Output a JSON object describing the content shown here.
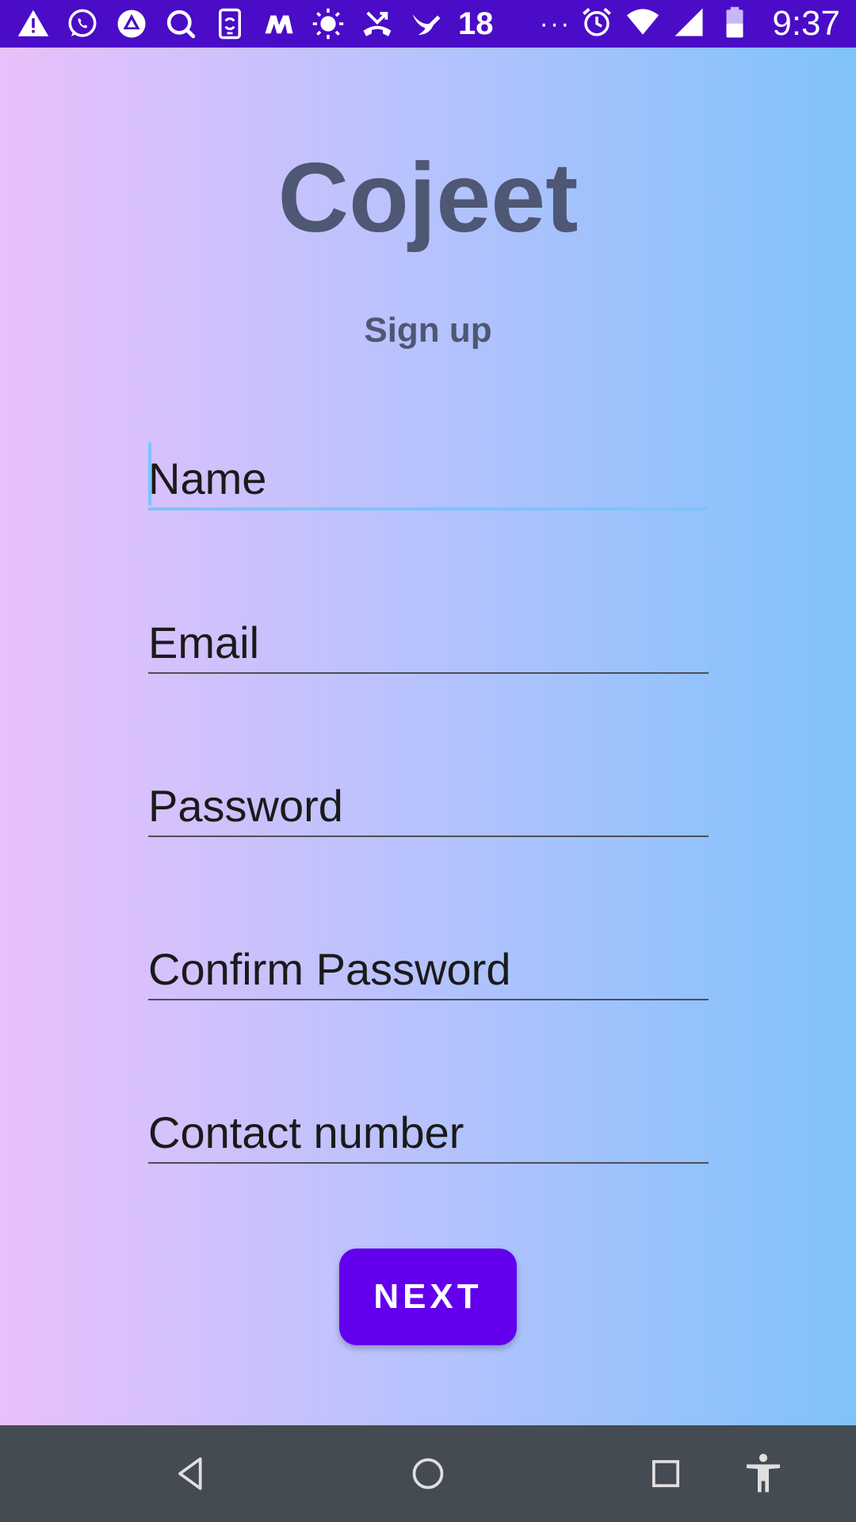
{
  "status_bar": {
    "notification_count": "18",
    "more_indicator": "···",
    "time": "9:37",
    "icons": [
      "warning-icon",
      "whatsapp-icon",
      "drive-icon",
      "search-icon",
      "phone-sync-icon",
      "m-app-icon",
      "brightness-icon",
      "missed-call-icon",
      "bird-icon",
      "alarm-icon",
      "wifi-icon",
      "signal-icon",
      "battery-icon"
    ],
    "background": "#4a0cc7"
  },
  "app": {
    "title": "Cojeet",
    "subtitle": "Sign up"
  },
  "form": {
    "name_placeholder": "Name",
    "email_placeholder": "Email",
    "password_placeholder": "Password",
    "confirm_password_placeholder": "Confirm Password",
    "contact_placeholder": "Contact number",
    "focused_field": "name",
    "accent_color": "#7fc3fb"
  },
  "next_button": {
    "label": "NEXT",
    "color": "#6200ee"
  },
  "nav_bar": {
    "icons": [
      "back-icon",
      "home-icon",
      "recents-icon",
      "accessibility-icon"
    ],
    "background": "#454b52"
  }
}
